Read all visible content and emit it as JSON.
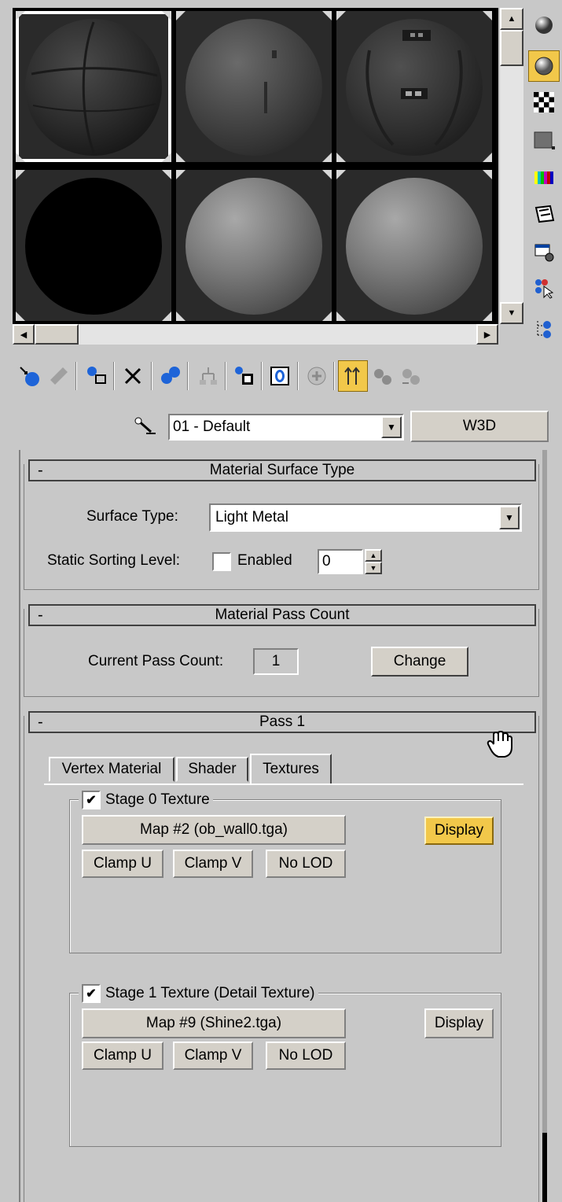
{
  "slots": [
    {
      "id": 1,
      "style": "concrete",
      "active": true
    },
    {
      "id": 2,
      "style": "concrete",
      "active": false
    },
    {
      "id": 3,
      "style": "concrete",
      "active": false
    },
    {
      "id": 4,
      "style": "black",
      "active": false
    },
    {
      "id": 5,
      "style": "gray",
      "active": false
    },
    {
      "id": 6,
      "style": "gray",
      "active": false
    }
  ],
  "side_icons": [
    "sample-type-sphere-icon",
    "backlight-icon",
    "background-checker-icon",
    "sample-uv-tiling-icon",
    "video-color-check-icon",
    "make-preview-icon",
    "options-icon",
    "select-by-material-icon",
    "material-map-navigator-icon"
  ],
  "toolbar_icons": [
    "get-material-icon",
    "put-material-icon",
    "assign-material-icon",
    "reset-map-icon",
    "make-unique-icon",
    "put-to-library-icon",
    "material-effects-channel-icon",
    "show-map-in-viewport-icon",
    "show-end-result-icon",
    "go-to-parent-icon",
    "go-forward-to-sibling-icon"
  ],
  "material": {
    "name": "01 - Default",
    "type_button": "W3D"
  },
  "surface_rollout": {
    "title": "Material Surface Type",
    "collapse_symbol": "-",
    "surface_type_label": "Surface Type:",
    "surface_type_value": "Light Metal",
    "sorting_label": "Static Sorting Level:",
    "enabled_label": "Enabled",
    "sorting_value": "0"
  },
  "pass_count_rollout": {
    "title": "Material Pass Count",
    "collapse_symbol": "-",
    "current_label": "Current Pass Count:",
    "current_value": "1",
    "change_button": "Change"
  },
  "pass1_rollout": {
    "title": "Pass 1",
    "collapse_symbol": "-",
    "tabs": [
      "Vertex Material",
      "Shader",
      "Textures"
    ],
    "active_tab": "Textures",
    "stage0": {
      "label": "Stage 0 Texture",
      "checked": "✔",
      "map": "Map #2 (ob_wall0.tga)",
      "display": "Display",
      "clamp_u": "Clamp U",
      "clamp_v": "Clamp V",
      "no_lod": "No LOD"
    },
    "stage1": {
      "label": "Stage 1 Texture (Detail Texture)",
      "checked": "✔",
      "map": "Map #9 (Shine2.tga)",
      "display": "Display",
      "clamp_u": "Clamp U",
      "clamp_v": "Clamp V",
      "no_lod": "No LOD"
    }
  },
  "colors": {
    "panel_bg": "#c8c8c8",
    "highlight_yellow": "#f2c84a"
  }
}
